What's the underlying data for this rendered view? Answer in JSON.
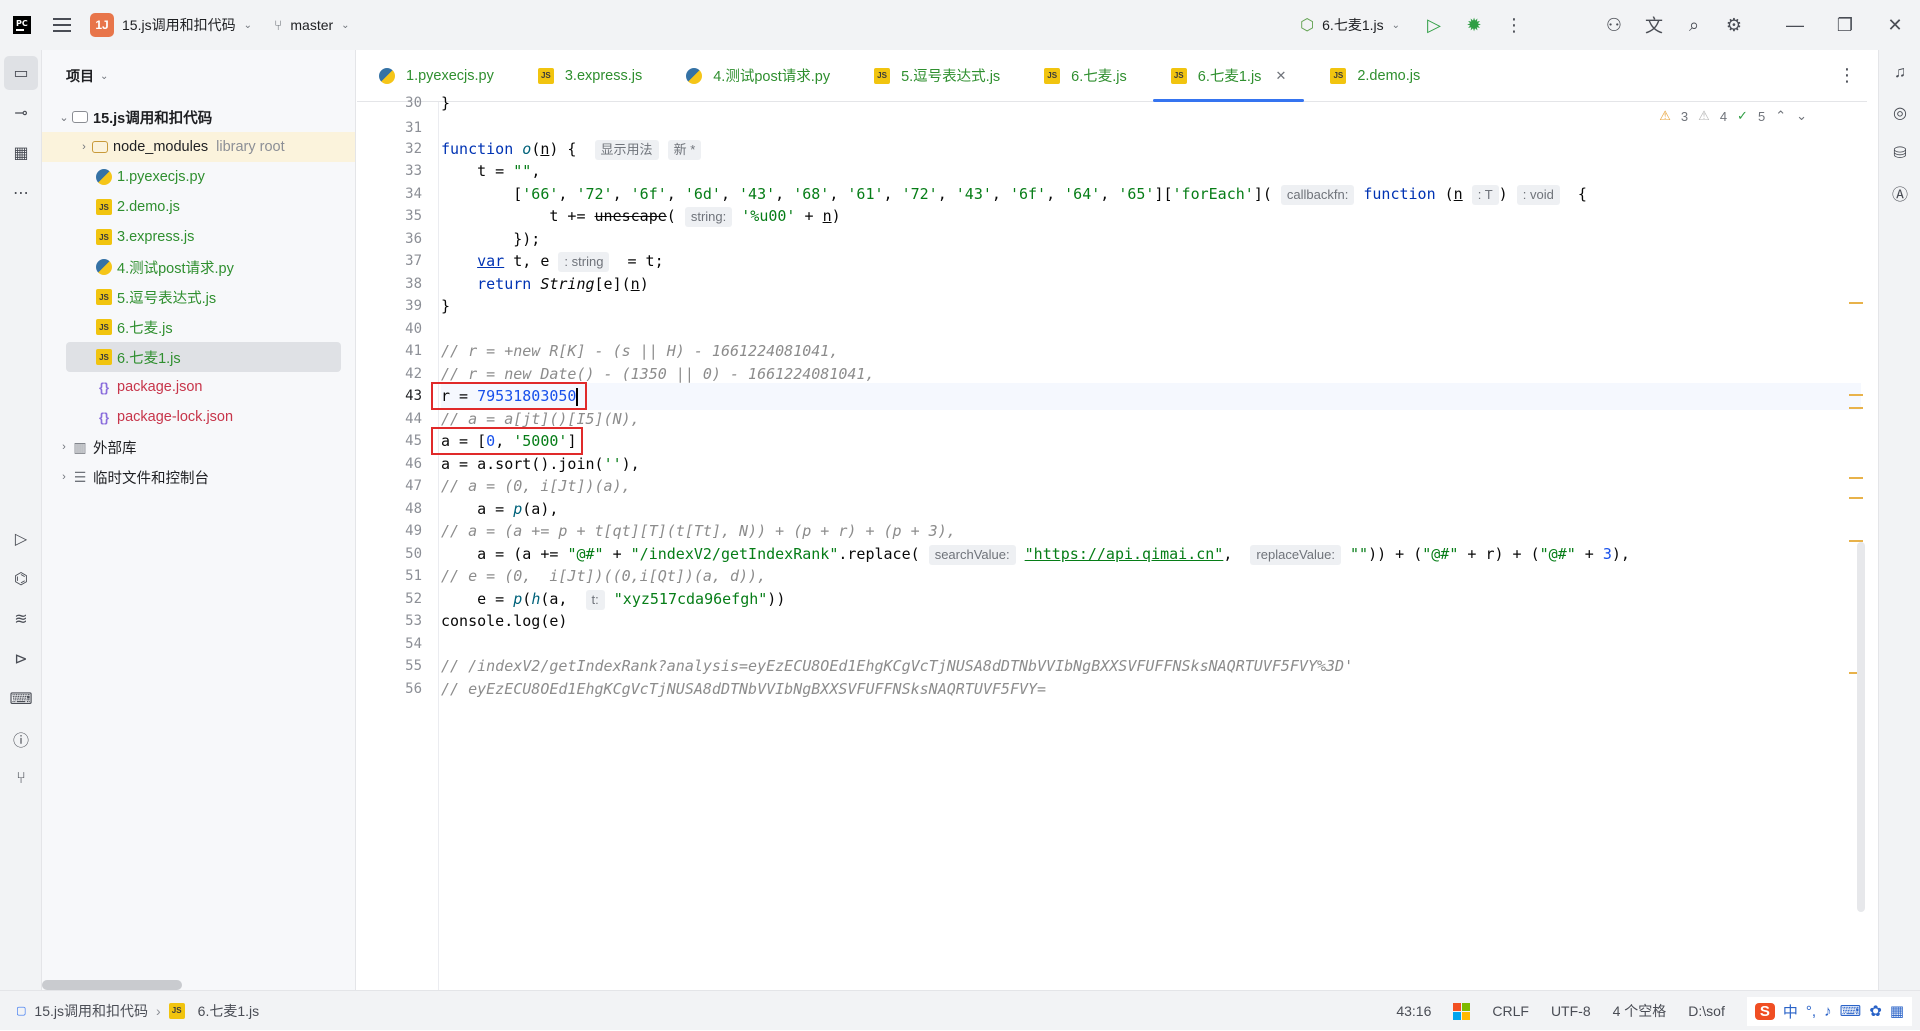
{
  "titlebar": {
    "project_badge": "1J",
    "project_name": "15.js调用和扣代码",
    "branch": "master",
    "run_config": "6.七麦1.js"
  },
  "project_panel": {
    "title": "项目",
    "root": "15.js调用和扣代码",
    "items": [
      {
        "label": "node_modules",
        "extra": "library root",
        "type": "folder"
      },
      {
        "label": "1.pyexecjs.py",
        "type": "py"
      },
      {
        "label": "2.demo.js",
        "type": "js"
      },
      {
        "label": "3.express.js",
        "type": "js"
      },
      {
        "label": "4.测试post请求.py",
        "type": "py"
      },
      {
        "label": "5.逗号表达式.js",
        "type": "js"
      },
      {
        "label": "6.七麦.js",
        "type": "js"
      },
      {
        "label": "6.七麦1.js",
        "type": "js"
      },
      {
        "label": "package.json",
        "type": "json"
      },
      {
        "label": "package-lock.json",
        "type": "json"
      },
      {
        "label": "外部库",
        "type": "lib"
      },
      {
        "label": "临时文件和控制台",
        "type": "scratch"
      }
    ]
  },
  "tabs": [
    {
      "label": "1.pyexecjs.py",
      "icon": "py"
    },
    {
      "label": "3.express.js",
      "icon": "js"
    },
    {
      "label": "4.测试post请求.py",
      "icon": "py"
    },
    {
      "label": "5.逗号表达式.js",
      "icon": "js"
    },
    {
      "label": "6.七麦.js",
      "icon": "js"
    },
    {
      "label": "6.七麦1.js",
      "icon": "js",
      "active": true
    },
    {
      "label": "2.demo.js",
      "icon": "js"
    }
  ],
  "inspections": {
    "warnings": "3",
    "weak_warnings": "4",
    "ok": "5"
  },
  "editor": {
    "current_line": 43,
    "line_numbers": [
      "30",
      "31",
      "32",
      "33",
      "34",
      "35",
      "36",
      "37",
      "38",
      "39",
      "40",
      "41",
      "42",
      "43",
      "44",
      "45",
      "46",
      "47",
      "48",
      "49",
      "50",
      "51",
      "52",
      "53",
      "54",
      "55",
      "56"
    ],
    "hint_usage": "显示用法",
    "hint_new": "新 *",
    "hint_callbackfn": "callbackfn:",
    "hint_T": ": T",
    "hint_void": ": void",
    "hint_string_param": "string:",
    "hint_string_type": ": string",
    "hint_searchValue": "searchValue:",
    "hint_replaceValue": "replaceValue:",
    "hint_t": "t:"
  },
  "statusbar": {
    "breadcrumb_project": "15.js调用和扣代码",
    "breadcrumb_file": "6.七麦1.js",
    "position": "43:16",
    "line_ending": "CRLF",
    "encoding": "UTF-8",
    "indent": "4 个空格",
    "path": "D:\\sof",
    "ime_lang": "中"
  }
}
